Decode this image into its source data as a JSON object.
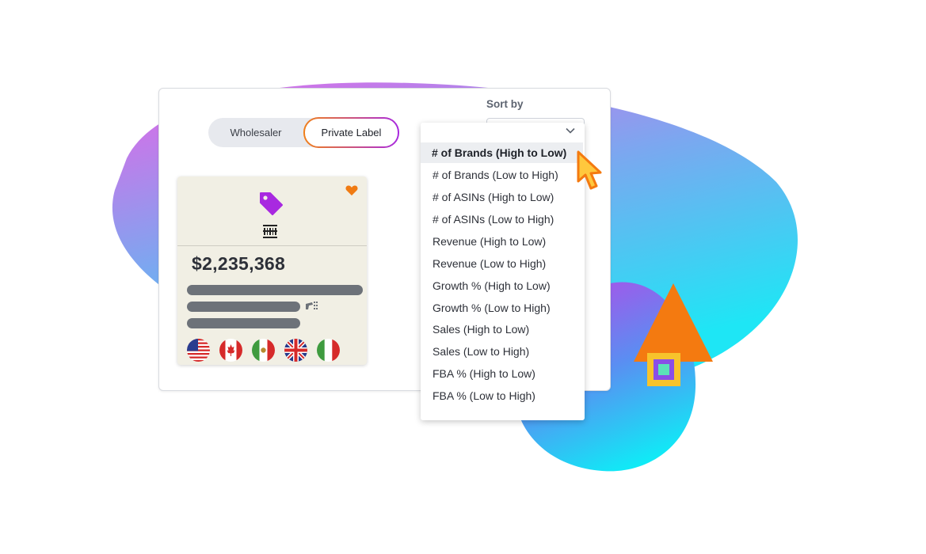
{
  "toggle": {
    "left_label": "Wholesaler",
    "right_label": "Private Label",
    "selected": "Private Label"
  },
  "sort": {
    "label": "Sort by",
    "options": [
      "# of Brands (High to Low)",
      "# of Brands (Low to High)",
      "# of ASINs (High to Low)",
      "# of ASINs (Low to High)",
      "Revenue (High to Low)",
      "Revenue (Low to High)",
      "Growth % (High to Low)",
      "Growth % (Low to High)",
      "Sales (High to Low)",
      "Sales (Low to High)",
      "FBA % (High to Low)",
      "FBA % (Low to High)"
    ],
    "highlighted": "# of Brands (High to Low)"
  },
  "card": {
    "price": "$2,235,368",
    "icons": [
      "tag-icon",
      "barcode-icon",
      "heart-icon",
      "truck-icon"
    ],
    "flags": [
      "us-flag",
      "ca-flag",
      "mx-flag",
      "uk-flag",
      "it-flag"
    ]
  },
  "colors": {
    "accent_orange": "#f47a10",
    "accent_purple": "#a829e0",
    "heart": "#f07b13",
    "tag": "#a829e0",
    "bar": "#6d7279"
  }
}
